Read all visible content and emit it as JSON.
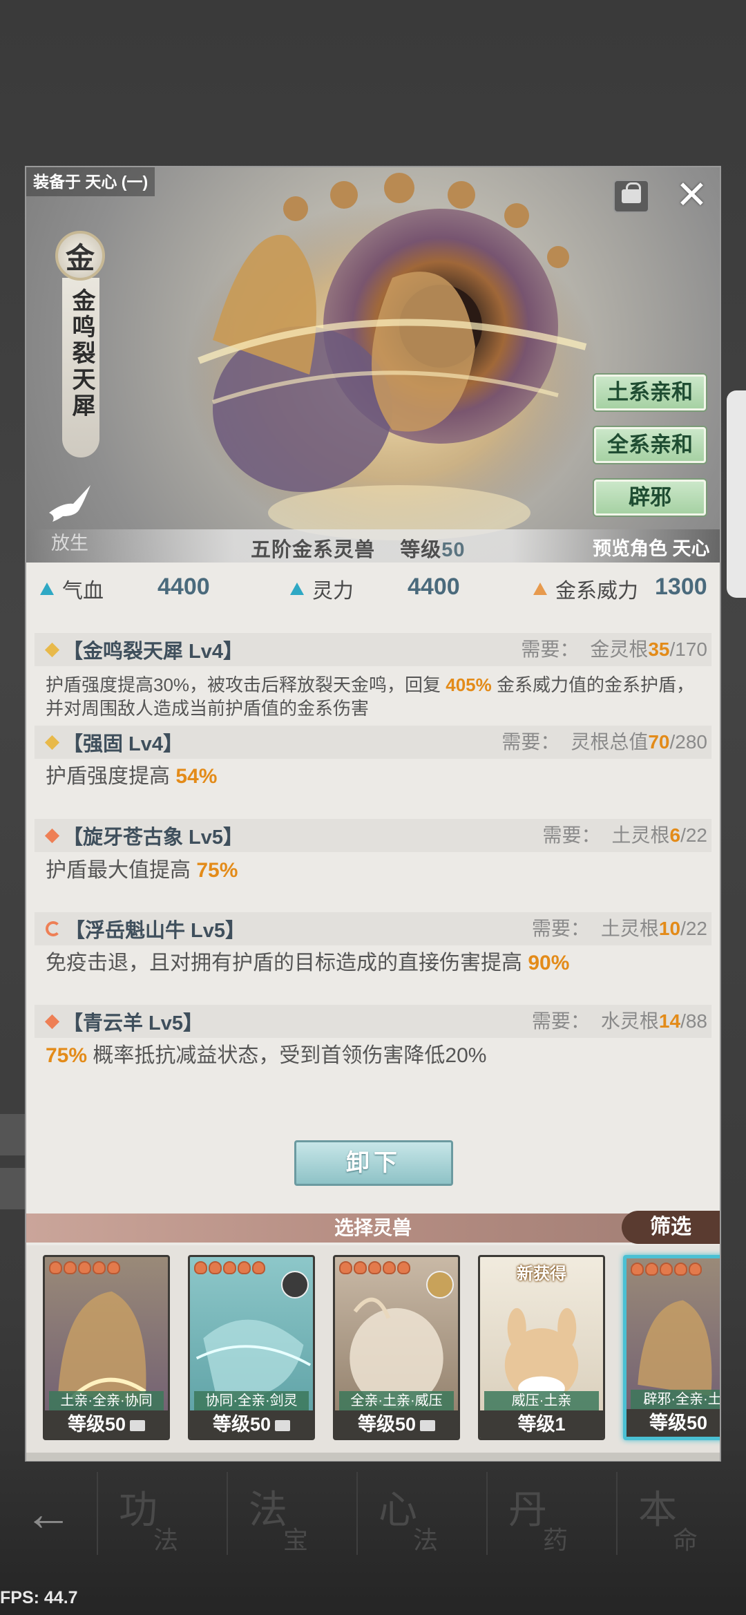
{
  "equip_label": "装备于 天心 (一)",
  "element": "金",
  "beast_name": "金鸣裂天犀",
  "release_label": "放生",
  "traits": [
    "土系亲和",
    "全系亲和",
    "辟邪"
  ],
  "tier": "五阶金系灵兽",
  "level_label": "等级",
  "level_value": "50",
  "preview": "预览角色 天心",
  "stats": {
    "hp_label": "气血",
    "hp_value": "4400",
    "spirit_label": "灵力",
    "spirit_value": "4400",
    "power_label": "金系威力",
    "power_value": "1300"
  },
  "skills": [
    {
      "name": "【金鸣裂天犀 Lv4】",
      "need": "需要：",
      "req_label": "金灵根",
      "req_cur": "35",
      "req_max": "/170",
      "desc_a": "护盾强度提高30%，被攻击后释放裂天金鸣，回复 ",
      "desc_hl": "405%",
      "desc_b": " 金系威力值的金系护盾，并对周围敌人造成当前护盾值的金系伤害"
    },
    {
      "name": "【强固 Lv4】",
      "need": "需要：",
      "req_label": "灵根总值",
      "req_cur": "70",
      "req_max": "/280",
      "desc_a": "护盾强度提高 ",
      "desc_hl": "54%",
      "desc_b": ""
    },
    {
      "name": "【旋牙苍古象 Lv5】",
      "need": "需要：",
      "req_label": "土灵根",
      "req_cur": "6",
      "req_max": "/22",
      "desc_a": "护盾最大值提高 ",
      "desc_hl": "75%",
      "desc_b": ""
    },
    {
      "name": "【浮岳魁山牛 Lv5】",
      "need": "需要：",
      "req_label": "土灵根",
      "req_cur": "10",
      "req_max": "/22",
      "desc_a": "免疫击退，且对拥有护盾的目标造成的直接伤害提高 ",
      "desc_hl": "90%",
      "desc_b": ""
    },
    {
      "name": "【青云羊 Lv5】",
      "need": "需要：",
      "req_label": "水灵根",
      "req_cur": "14",
      "req_max": "/88",
      "desc_a": "",
      "desc_hl": "75%",
      "desc_b": " 概率抵抗减益状态，受到首领伤害降低20%"
    }
  ],
  "unload_label": "卸下",
  "select_label": "选择灵兽",
  "filter_label": "筛选",
  "cards": [
    {
      "tag": "土亲·全亲·协同",
      "level": "等级50"
    },
    {
      "tag": "协同·全亲·剑灵",
      "level": "等级50"
    },
    {
      "tag": "全亲·土亲·威压",
      "level": "等级50"
    },
    {
      "tag": "威压·土亲",
      "level": "等级1",
      "badge": "新获得"
    },
    {
      "tag": "辟邪·全亲·土",
      "level": "等级50"
    }
  ],
  "nav": [
    {
      "big": "功",
      "small": "法"
    },
    {
      "big": "法",
      "small": "宝"
    },
    {
      "big": "心",
      "small": "法"
    },
    {
      "big": "丹",
      "small": "药"
    },
    {
      "big": "本",
      "small": "命"
    }
  ],
  "fps": "FPS: 44.7",
  "colors": {
    "accent_orange": "#e38b19",
    "stat_blue": "#4a6a7c",
    "select_bar": "#b58d82",
    "card_selected": "#4ac0d3"
  }
}
